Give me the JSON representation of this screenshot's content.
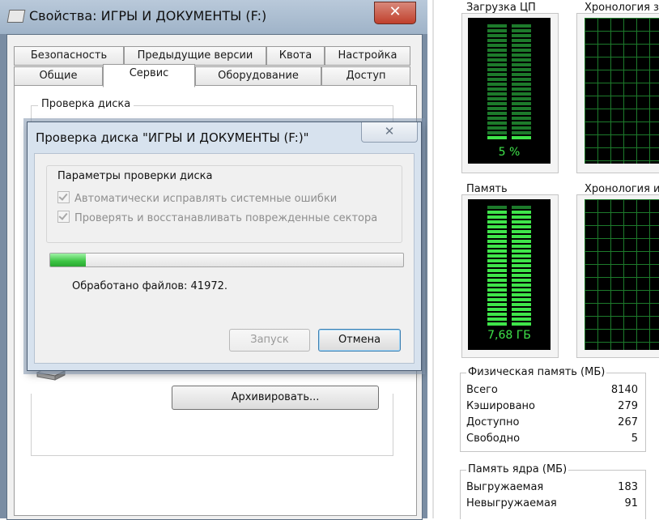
{
  "properties_window": {
    "title": "Свойства: ИГРЫ И ДОКУМЕНТЫ (F:)",
    "close_glyph": "✕",
    "tabs_row1": [
      "Безопасность",
      "Предыдущие версии",
      "Квота",
      "Настройка"
    ],
    "tabs_row2": [
      "Общие",
      "Сервис",
      "Оборудование",
      "Доступ"
    ],
    "active_tab": "Сервис",
    "check_disk_group_label": "Проверка диска",
    "archive_button": "Архивировать..."
  },
  "check_disk_dialog": {
    "title": "Проверка диска \"ИГРЫ И ДОКУМЕНТЫ (F:)\"",
    "close_glyph": "✕",
    "options_label": "Параметры проверки диска",
    "option_auto_fix": "Автоматически исправлять системные ошибки",
    "option_recover": "Проверять и восстанавливать поврежденные сектора",
    "progress_fraction": 0.1,
    "processed_text": "Обработано файлов: 41972.",
    "start_button": "Запуск",
    "cancel_button": "Отмена"
  },
  "task_manager": {
    "cpu_label": "Загрузка ЦП",
    "cpu_history_label": "Хронология загрузки ЦП",
    "cpu_value": "5 %",
    "cpu_level": 0.05,
    "memory_label": "Память",
    "memory_history_label": "Хронология использования физической памяти",
    "memory_value": "7,68 ГБ",
    "memory_level": 0.94,
    "physical_memory": {
      "header": "Физическая память (МБ)",
      "rows": [
        {
          "label": "Всего",
          "value": "8140"
        },
        {
          "label": "Кэшировано",
          "value": "279"
        },
        {
          "label": "Доступно",
          "value": "267"
        },
        {
          "label": "Свободно",
          "value": "5"
        }
      ]
    },
    "kernel_memory": {
      "header": "Память ядра (МБ)",
      "rows": [
        {
          "label": "Выгружаемая",
          "value": "183"
        },
        {
          "label": "Невыгружаемая",
          "value": "91"
        }
      ]
    },
    "meter_color": "#3fe54a",
    "grid_color": "#1d7a2b"
  }
}
